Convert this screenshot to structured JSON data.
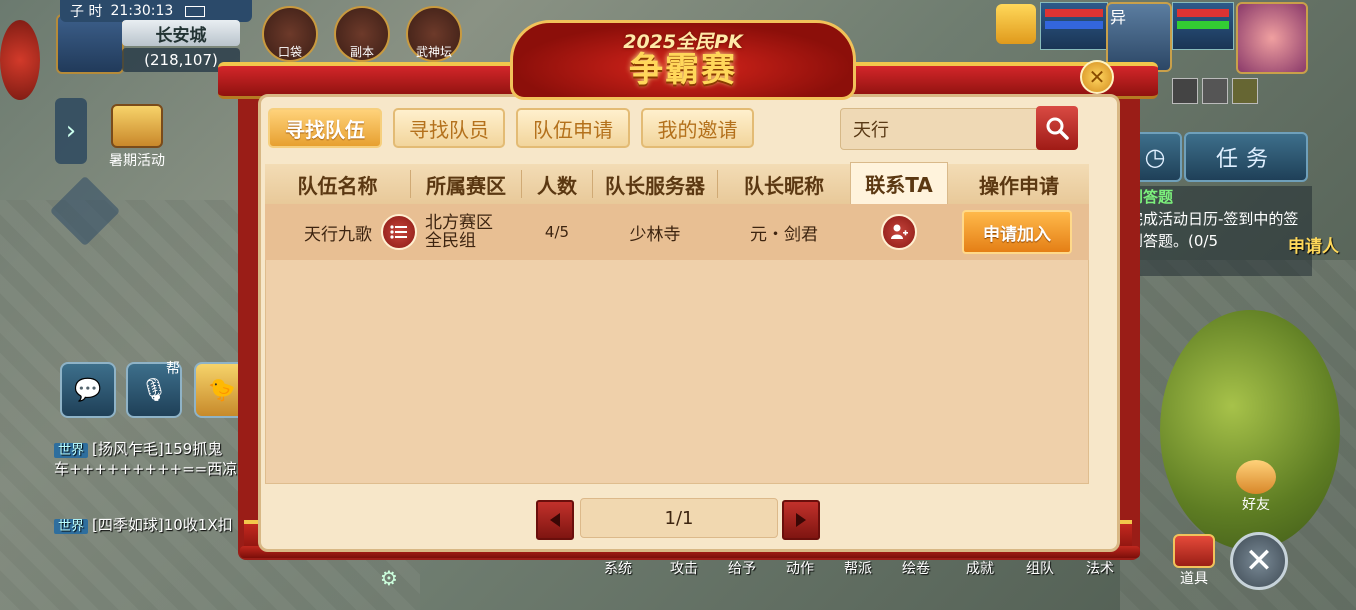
{
  "hud": {
    "shichen": "子 时",
    "clock": "21:30:13",
    "city": "长安城",
    "coords": "(218,107)",
    "top_buttons": [
      {
        "label": "口袋",
        "icon": "pouch-icon"
      },
      {
        "label": "副本",
        "icon": "dungeon-icon"
      },
      {
        "label": "武神坛",
        "icon": "martial-altar-icon"
      }
    ],
    "event_label": "暑期活动",
    "right_player_tag": "异"
  },
  "dialog": {
    "title_small": "2025全民PK",
    "title_big": "争霸赛",
    "tabs": [
      {
        "label": "寻找队伍",
        "active": true
      },
      {
        "label": "寻找队员",
        "active": false
      },
      {
        "label": "队伍申请",
        "active": false
      },
      {
        "label": "我的邀请",
        "active": false
      }
    ],
    "search": {
      "value": "天行"
    },
    "columns": [
      "队伍名称",
      "所属赛区",
      "人数",
      "队长服务器",
      "队长昵称",
      "联系TA",
      "操作申请"
    ],
    "active_column": "联系TA",
    "rows": [
      {
        "team_name": "天行九歌",
        "region_line1": "北方赛区",
        "region_line2": "全民组",
        "members": "4/5",
        "server": "少林寺",
        "captain": "元・剑君",
        "apply_label": "申请加入"
      }
    ],
    "pagination": "1/1"
  },
  "chat": {
    "lines": [
      {
        "channel": "世界",
        "text": "[扬风乍毛]159抓鬼"
      },
      {
        "channel": "",
        "text": "车+++++++++==西凉"
      },
      {
        "channel": "世界",
        "text": "[四季如球]10收1X扣"
      }
    ],
    "mic_label": "帮"
  },
  "task": {
    "button_label": "任务",
    "title": "到答题",
    "text": "完成活动日历-签到中的签到答题。(0/5",
    "side_label": "申请人"
  },
  "bottom_menu": [
    "系统",
    "攻击",
    "给予",
    "动作",
    "帮派",
    "绘卷",
    "成就",
    "组队",
    "法术"
  ],
  "bag_label": "道具",
  "friend_label": "好友"
}
